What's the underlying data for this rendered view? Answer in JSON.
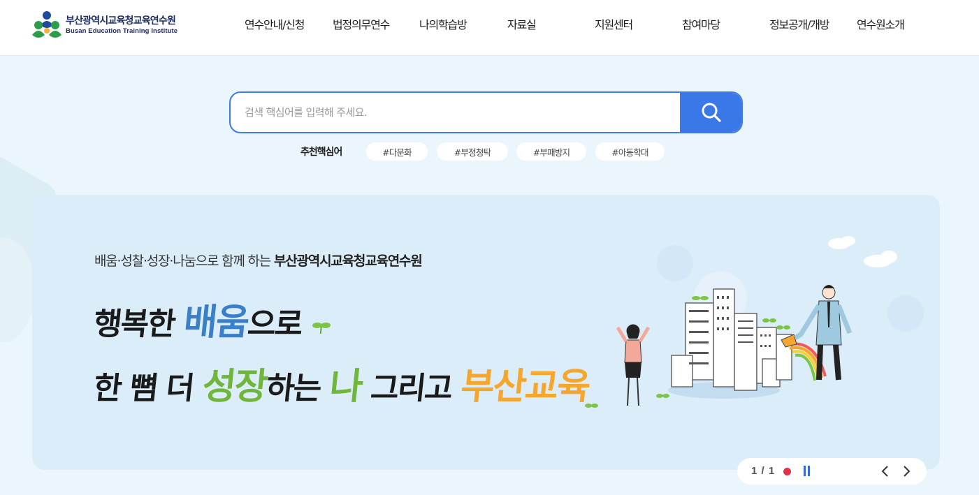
{
  "header": {
    "logo_ko": "부산광역시교육청교육연수원",
    "logo_en": "Busan Education Training Institute",
    "nav": [
      {
        "label": "연수안내/신청"
      },
      {
        "label": "법정의무연수"
      },
      {
        "label": "나의학습방"
      },
      {
        "label": "자료실"
      },
      {
        "label": "지원센터"
      },
      {
        "label": "참여마당"
      },
      {
        "label": "정보공개/개방"
      },
      {
        "label": "연수원소개"
      }
    ]
  },
  "search": {
    "placeholder": "검색 핵심어를 입력해 주세요.",
    "value": "",
    "button_icon": "search-icon"
  },
  "keywords": {
    "label": "추천핵심어",
    "chips": [
      "#다문화",
      "#부정청탁",
      "#부패방지",
      "#아동학대"
    ]
  },
  "banner": {
    "subtitle_prefix": "배움·성찰·성장·나눔으로 함께 하는",
    "subtitle_bold": "부산광역시교육청교육연수원",
    "line1_a": "행복한",
    "line1_hl": "배움",
    "line1_b": "으로",
    "line2_a": "한 뼘 더",
    "line2_hl1": "성장",
    "line2_b": "하는",
    "line2_hl2": "나",
    "line2_c": "그리고",
    "line2_hl3": "부산교육"
  },
  "slider": {
    "counter": "1 / 1",
    "prev_icon": "chevron-left-icon",
    "next_icon": "chevron-right-icon",
    "pause_icon": "pause-icon"
  },
  "colors": {
    "accent_blue": "#3a78e8",
    "page_bg": "#eaf6fb",
    "banner_bg": "#dcedfa",
    "highlight_blue": "#3b7fc8",
    "highlight_green": "#6fb63b",
    "highlight_orange": "#f6a52d",
    "indicator_red": "#e0334a"
  }
}
